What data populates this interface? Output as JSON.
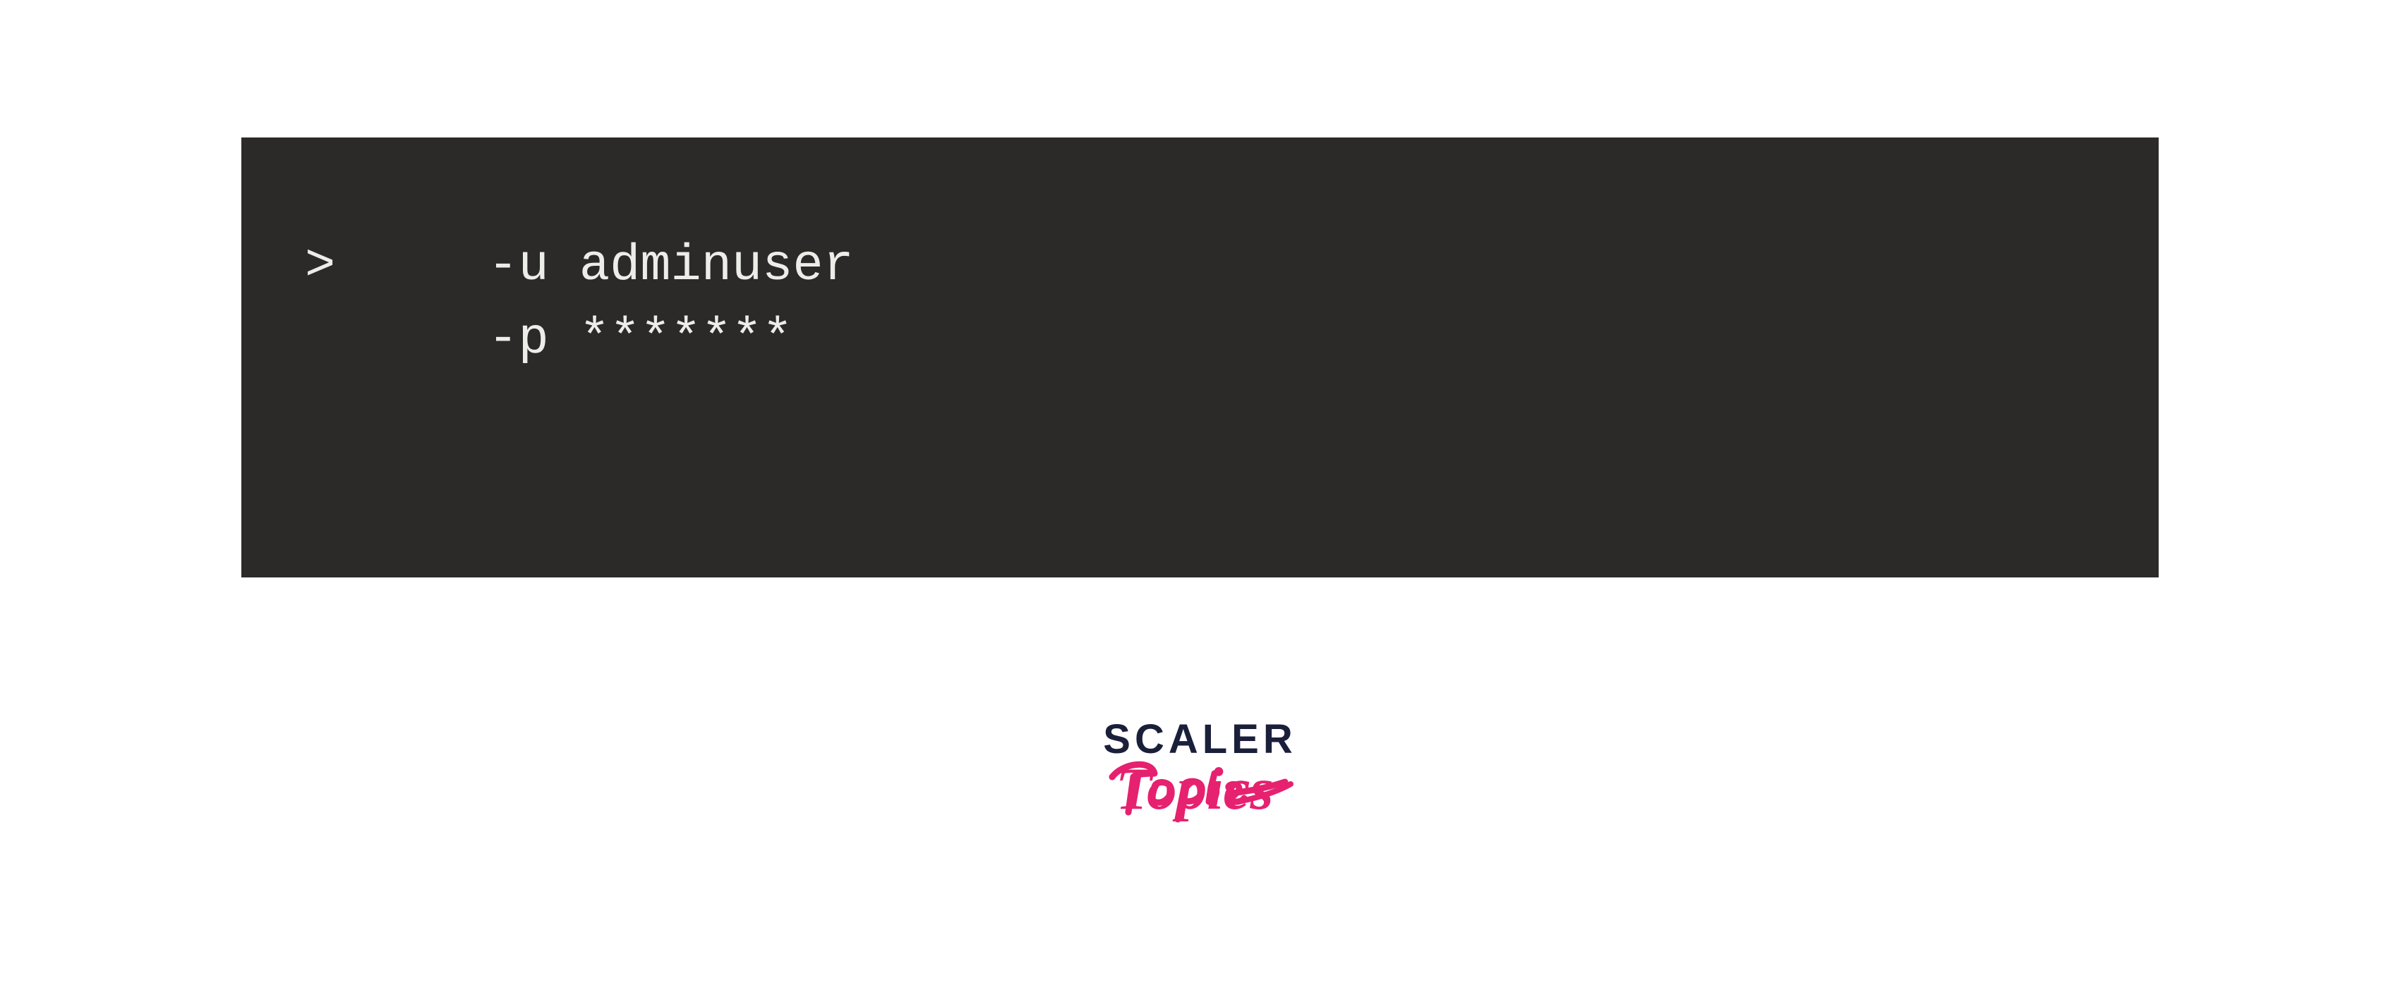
{
  "terminal": {
    "prompt": ">",
    "line1": "     -u adminuser",
    "line2": "      -p *******"
  },
  "logo": {
    "scaler_text": "SCALER",
    "topics_text": "Topics",
    "scaler_color": "#1a1f3a",
    "topics_color": "#e6216f"
  }
}
